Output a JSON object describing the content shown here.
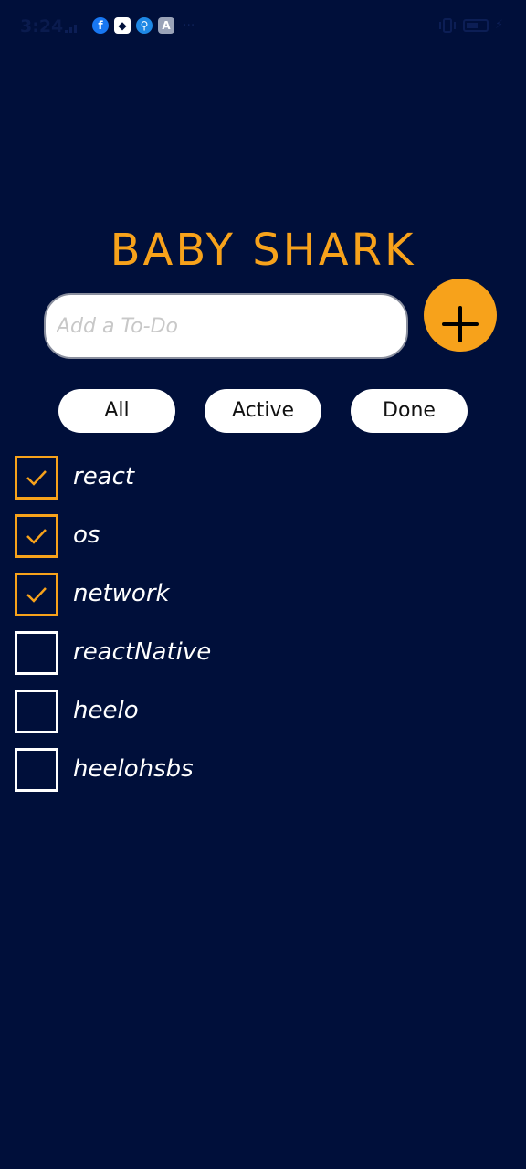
{
  "status_bar": {
    "time": "3:24",
    "more": "···",
    "icons": [
      "signal-icon",
      "facebook-icon",
      "notification-icon",
      "usb-icon",
      "app-store-icon",
      "vibrate-icon",
      "battery-icon",
      "charging-icon"
    ]
  },
  "app": {
    "title": "BABY SHARK"
  },
  "input": {
    "placeholder": "Add a To-Do",
    "value": ""
  },
  "add_button": {
    "icon": "plus-icon"
  },
  "filters": [
    {
      "label": "All"
    },
    {
      "label": "Active"
    },
    {
      "label": "Done"
    }
  ],
  "todos": [
    {
      "text": "react",
      "done": true
    },
    {
      "text": "os",
      "done": true
    },
    {
      "text": "network",
      "done": true
    },
    {
      "text": "reactNative",
      "done": false
    },
    {
      "text": "heelo",
      "done": false
    },
    {
      "text": "heelohsbs",
      "done": false
    }
  ],
  "colors": {
    "background": "#000f3a",
    "accent": "#f7a21b",
    "checkbox_unchecked": "#ffffff"
  }
}
